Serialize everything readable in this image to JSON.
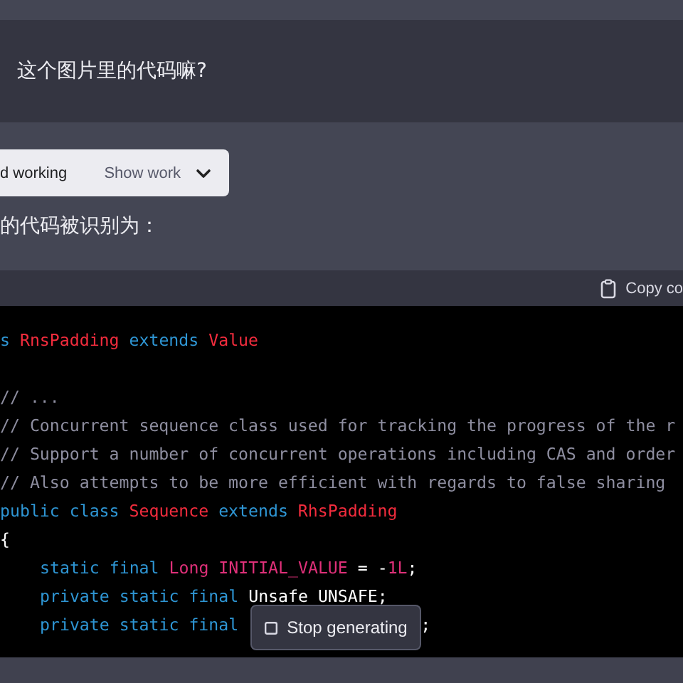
{
  "user_message": "这个图片里的代码嘛?",
  "assistant": {
    "work_panel": {
      "status": "d working",
      "toggle": "Show work",
      "expanded": false
    },
    "intro": "的代码被识别为：",
    "code_block": {
      "copy_button": "Copy co",
      "paragraphs": [
        [
          {
            "indented": false,
            "segments": [
              [
                {
                  "kind": "kw",
                  "text": "s "
                },
                {
                  "kind": "cls",
                  "text": "RnsPadding"
                },
                {
                  "kind": "kw",
                  "text": " extends "
                },
                {
                  "kind": "cls",
                  "text": "Value"
                }
              ]
            ]
          }
        ],
        [
          {
            "indented": false,
            "segments": [
              [
                {
                  "kind": "comment",
                  "text": "// ..."
                }
              ]
            ]
          },
          {
            "indented": false,
            "segments": [
              [
                {
                  "kind": "comment",
                  "text": "// Concurrent sequence class used for tracking the progress of the r"
                }
              ]
            ]
          },
          {
            "indented": false,
            "segments": [
              [
                {
                  "kind": "comment",
                  "text": "// Support a number of concurrent operations including CAS and order"
                }
              ]
            ]
          },
          {
            "indented": false,
            "segments": [
              [
                {
                  "kind": "comment",
                  "text": "// Also attempts to be more efficient with regards to false sharing"
                }
              ]
            ]
          },
          {
            "indented": false,
            "segments": [
              [
                {
                  "kind": "kw",
                  "text": "public class "
                },
                {
                  "kind": "cls",
                  "text": "Sequence"
                },
                {
                  "kind": "kw",
                  "text": " extends "
                },
                {
                  "kind": "cls",
                  "text": "RhsPadding"
                }
              ]
            ]
          },
          {
            "indented": false,
            "segments": [
              [
                {
                  "kind": "plain",
                  "text": "{"
                }
              ]
            ]
          },
          {
            "indented": true,
            "segments": [
              [
                {
                  "kind": "kw",
                  "text": "static final "
                },
                {
                  "kind": "type",
                  "text": "Long INITIAL_VALUE"
                },
                {
                  "kind": "plain",
                  "text": " = -"
                },
                {
                  "kind": "num",
                  "text": "1L"
                },
                {
                  "kind": "plain",
                  "text": ";"
                }
              ]
            ]
          },
          {
            "indented": true,
            "segments": [
              [
                {
                  "kind": "kw",
                  "text": "private static final "
                },
                {
                  "kind": "plain",
                  "text": "Unsafe UNSAFE;"
                }
              ]
            ]
          },
          {
            "indented": true,
            "segments": [
              [
                {
                  "kind": "kw",
                  "text": "private static final"
                }
              ],
              [
                {
                  "kind": "plain",
                  "text": ";"
                }
              ]
            ]
          }
        ]
      ]
    }
  },
  "stop_button": {
    "label": "Stop generating"
  }
}
